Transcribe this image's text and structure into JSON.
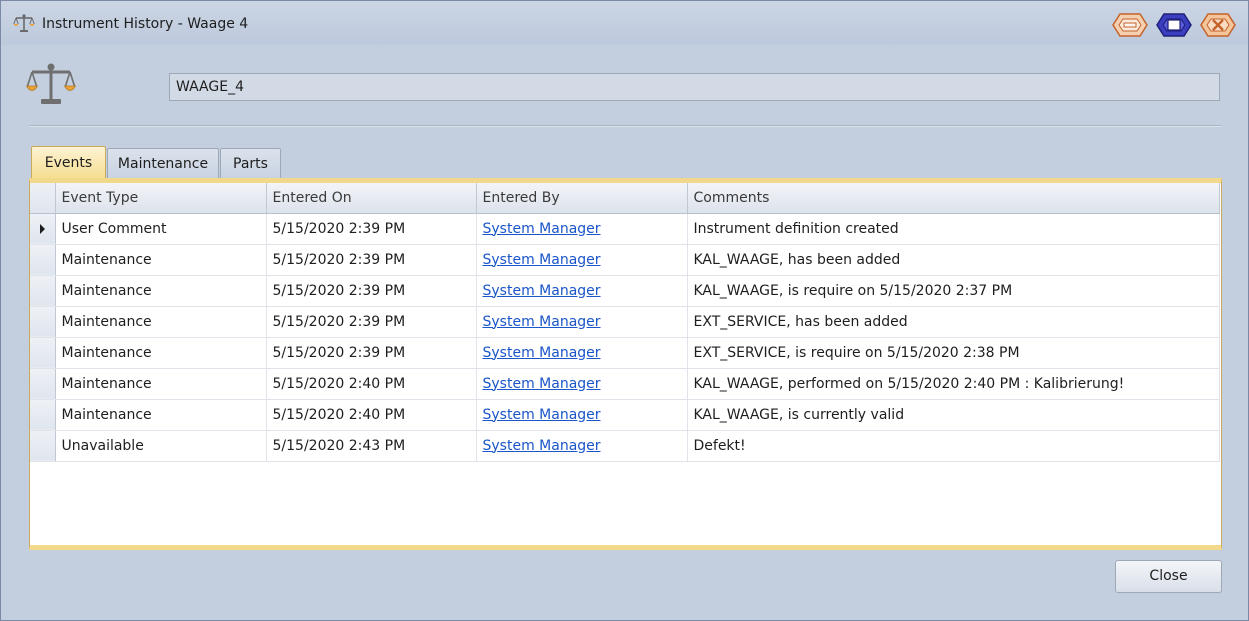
{
  "window": {
    "title": "Instrument History - Waage 4"
  },
  "instrument": {
    "name_value": "WAAGE_4"
  },
  "tabs": [
    {
      "label": "Events",
      "active": true
    },
    {
      "label": "Maintenance",
      "active": false
    },
    {
      "label": "Parts",
      "active": false
    }
  ],
  "grid": {
    "columns": [
      "Event Type",
      "Entered On",
      "Entered By",
      "Comments"
    ],
    "rows": [
      {
        "event_type": "User Comment",
        "entered_on": "5/15/2020 2:39 PM",
        "entered_by": "System Manager",
        "comments": "Instrument definition created",
        "current": true
      },
      {
        "event_type": "Maintenance",
        "entered_on": "5/15/2020 2:39 PM",
        "entered_by": "System Manager",
        "comments": "KAL_WAAGE, has been added",
        "current": false
      },
      {
        "event_type": "Maintenance",
        "entered_on": "5/15/2020 2:39 PM",
        "entered_by": "System Manager",
        "comments": "KAL_WAAGE, is require on 5/15/2020 2:37 PM",
        "current": false
      },
      {
        "event_type": "Maintenance",
        "entered_on": "5/15/2020 2:39 PM",
        "entered_by": "System Manager",
        "comments": "EXT_SERVICE, has been added",
        "current": false
      },
      {
        "event_type": "Maintenance",
        "entered_on": "5/15/2020 2:39 PM",
        "entered_by": "System Manager",
        "comments": "EXT_SERVICE, is require on 5/15/2020 2:38 PM",
        "current": false
      },
      {
        "event_type": "Maintenance",
        "entered_on": "5/15/2020 2:40 PM",
        "entered_by": "System Manager",
        "comments": "KAL_WAAGE, performed on 5/15/2020 2:40 PM : Kalibrierung!",
        "current": false
      },
      {
        "event_type": "Maintenance",
        "entered_on": "5/15/2020 2:40 PM",
        "entered_by": "System Manager",
        "comments": "KAL_WAAGE, is currently valid",
        "current": false
      },
      {
        "event_type": "Unavailable",
        "entered_on": "5/15/2020 2:43 PM",
        "entered_by": "System Manager",
        "comments": "Defekt!",
        "current": false
      }
    ]
  },
  "buttons": {
    "close_label": "Close"
  },
  "icons": {
    "title_icon": "scale-icon",
    "instrument_icon": "scale-icon",
    "minimize": "minimize-icon",
    "maximize": "maximize-icon",
    "close": "close-icon"
  },
  "colors": {
    "tab_active": "#f5dc8e",
    "link": "#1a55c9",
    "window_bg": "#c3cedf"
  }
}
